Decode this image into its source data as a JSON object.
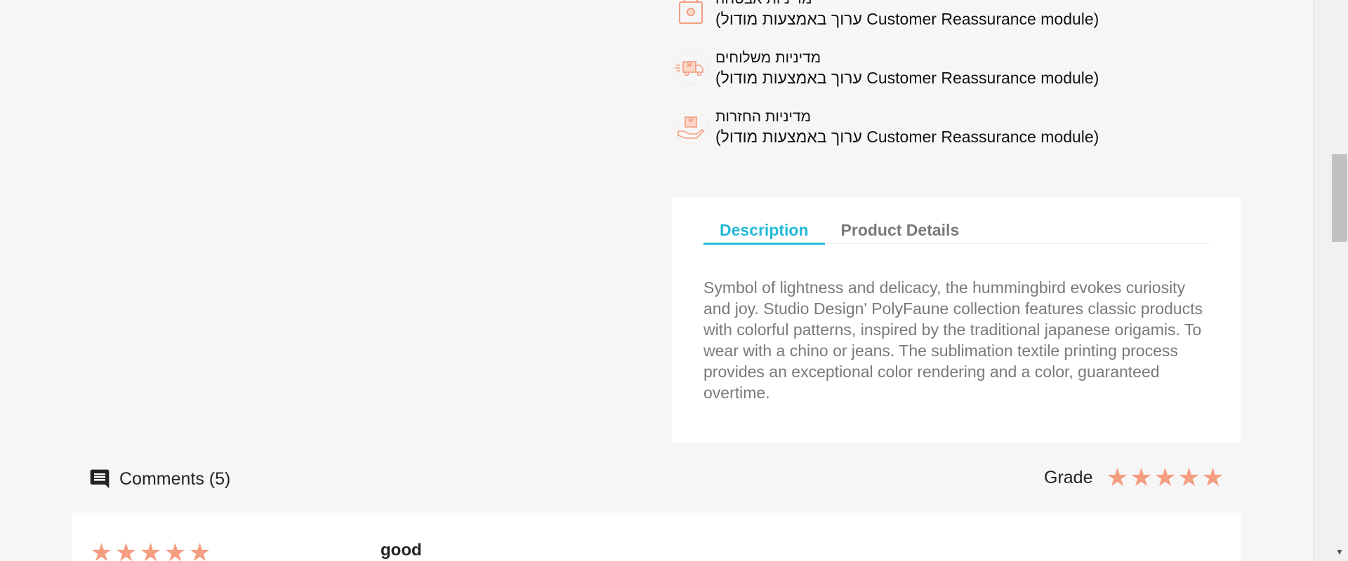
{
  "reassurance": {
    "items": [
      {
        "title": "מדיניות אבטחה",
        "desc": "(ערוך באמצעות מודול Customer Reassurance module)",
        "icon": "security-lock-icon"
      },
      {
        "title": "מדיניות משלוחים",
        "desc": "(ערוך באמצעות מודול Customer Reassurance module)",
        "icon": "delivery-truck-icon"
      },
      {
        "title": "מדיניות החזרות",
        "desc": "(ערוך באמצעות מודול Customer Reassurance module)",
        "icon": "return-package-icon"
      }
    ],
    "icon_color": "#f49d80"
  },
  "tabs": {
    "items": [
      {
        "label": "Description",
        "active": true
      },
      {
        "label": "Product Details",
        "active": false
      }
    ],
    "active_color": "#24b9d7",
    "description": "Symbol of lightness and delicacy, the hummingbird evokes curiosity and joy. Studio Design' PolyFaune collection features classic products with colorful patterns, inspired by the traditional japanese origamis. To wear with a chino or jeans. The sublimation textile printing process provides an exceptional color rendering and a color, guaranteed overtime."
  },
  "comments": {
    "label": "Comments (5)",
    "icon": "comment-icon",
    "grade_label": "Grade",
    "grade_stars": 5,
    "star_color": "#f49d80"
  },
  "review": {
    "stars": 5,
    "title": "good"
  }
}
